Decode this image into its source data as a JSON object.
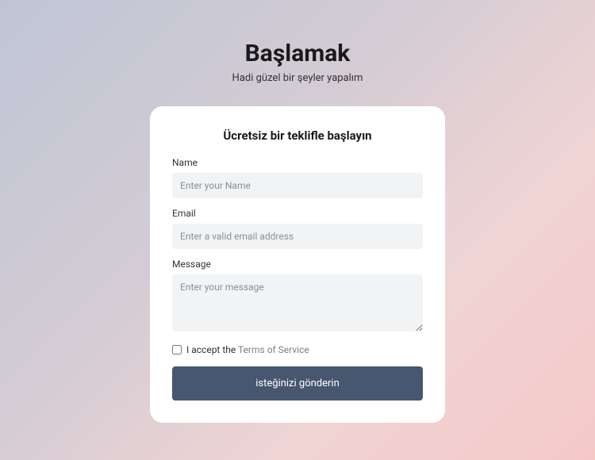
{
  "header": {
    "title": "Başlamak",
    "subtitle": "Hadi güzel bir şeyler yapalım"
  },
  "form": {
    "title": "Ücretsiz bir teklifle başlayın",
    "fields": {
      "name": {
        "label": "Name",
        "placeholder": "Enter your Name",
        "value": ""
      },
      "email": {
        "label": "Email",
        "placeholder": "Enter a valid email address",
        "value": ""
      },
      "message": {
        "label": "Message",
        "placeholder": "Enter your message",
        "value": ""
      }
    },
    "checkbox": {
      "prefix": "I accept the ",
      "link_text": "Terms of Service",
      "checked": false
    },
    "submit_label": "isteğinizi gönderin"
  }
}
